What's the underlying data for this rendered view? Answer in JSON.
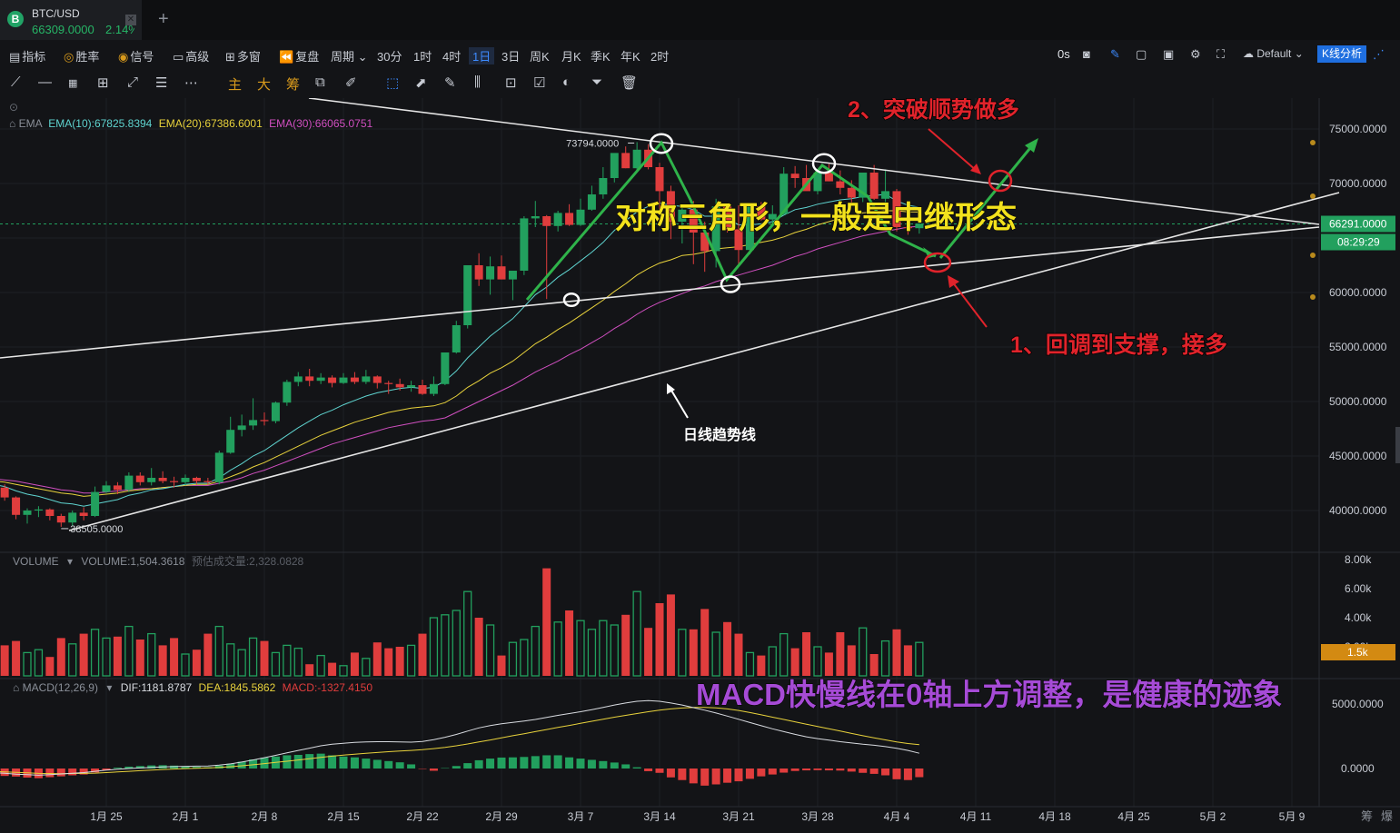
{
  "tab": {
    "symbol": "BTC/USD",
    "price": "66309.0000",
    "change": "2.14%",
    "logo": "B"
  },
  "toolbar": {
    "left": [
      {
        "label": "指标",
        "icon": "indicator-icon"
      },
      {
        "label": "胜率",
        "icon": "winrate-icon"
      },
      {
        "label": "信号",
        "icon": "signal-icon"
      },
      {
        "label": "高级",
        "icon": "advanced-icon"
      },
      {
        "label": "多窗",
        "icon": "multiwindow-icon"
      },
      {
        "label": "复盘",
        "icon": "replay-icon"
      },
      {
        "label": "周期"
      }
    ],
    "periods": [
      "30分",
      "1时",
      "4时",
      "1日",
      "3日",
      "周K",
      "月K",
      "季K",
      "年K",
      "2时"
    ],
    "selected_period": "1日",
    "right_zero": "0s",
    "theme": "Default",
    "kline_button": "K线分析"
  },
  "drawing_tools": {
    "text_tools": [
      "主",
      "大",
      "筹"
    ]
  },
  "ema_legend": {
    "name": "EMA",
    "ema10": "EMA(10):67825.8394",
    "ema20": "EMA(20):67386.6001",
    "ema30": "EMA(30):66065.0751"
  },
  "volume_legend": {
    "name": "VOLUME",
    "value": "VOLUME:1,504.3618",
    "estimate": "预估成交量:2,328.0828"
  },
  "macd_legend": {
    "name": "MACD(12,26,9)",
    "dif": "DIF:1181.8787",
    "dea": "DEA:1845.5862",
    "macd": "MACD:-1327.4150"
  },
  "price_axis": {
    "ticks": [
      "75000.0000",
      "70000.0000",
      "65000.0000",
      "60000.0000",
      "55000.0000",
      "50000.0000",
      "45000.0000",
      "40000.0000"
    ],
    "current": "66291.0000",
    "countdown": "08:29:29"
  },
  "volume_axis": {
    "ticks": [
      "8.00k",
      "6.00k",
      "4.00k",
      "2.00k"
    ],
    "current": "1.5k"
  },
  "macd_axis": {
    "ticks": [
      "5000.0000",
      "0.0000"
    ]
  },
  "date_axis": [
    "1月 25",
    "2月 1",
    "2月 8",
    "2月 15",
    "2月 22",
    "2月 29",
    "3月 7",
    "3月 14",
    "3月 21",
    "3月 28",
    "4月 4",
    "4月 11",
    "4月 18",
    "4月 25",
    "5月 2",
    "5月 9"
  ],
  "corner_labels": [
    "筹",
    "爆"
  ],
  "markers": {
    "high": "73794.0000",
    "low": "38505.0000"
  },
  "annotations": {
    "title": "对称三角形，一般是中继形态",
    "step2": "2、突破顺势做多",
    "step1": "1、回调到支撑，接多",
    "trendline": "日线趋势线",
    "macd_note": "MACD快慢线在0轴上方调整，是健康的迹象"
  },
  "colors": {
    "up": "#22a05e",
    "down": "#e03d3d",
    "ema10": "#5fd4d0",
    "ema20": "#e8d23c",
    "ema30": "#d04fc0",
    "accent": "#3d8bff",
    "note_yellow": "#f3e21d",
    "note_red": "#e0232b",
    "note_purple": "#a64bd6"
  },
  "chart_data": {
    "type": "candlestick",
    "x_start": "2024-01-14",
    "ohlc": [
      [
        42800,
        43100,
        41600,
        41900
      ],
      [
        41900,
        42600,
        41000,
        42100
      ],
      [
        42100,
        42400,
        40900,
        41200
      ],
      [
        41200,
        41300,
        39200,
        39600
      ],
      [
        39600,
        40200,
        38800,
        40000
      ],
      [
        40000,
        40400,
        39400,
        40100
      ],
      [
        40100,
        40200,
        39100,
        39500
      ],
      [
        39500,
        39700,
        38505,
        38900
      ],
      [
        38900,
        40000,
        38600,
        39800
      ],
      [
        39800,
        40300,
        39100,
        39500
      ],
      [
        39500,
        42200,
        39400,
        41700
      ],
      [
        41700,
        42700,
        41600,
        42300
      ],
      [
        42300,
        42600,
        41500,
        41900
      ],
      [
        41900,
        43500,
        41700,
        43200
      ],
      [
        43200,
        43500,
        42300,
        42600
      ],
      [
        42600,
        43900,
        42300,
        43000
      ],
      [
        43000,
        43600,
        42500,
        42700
      ],
      [
        42700,
        43100,
        42100,
        42600
      ],
      [
        42600,
        43300,
        42300,
        43000
      ],
      [
        43000,
        43100,
        42400,
        42700
      ],
      [
        42700,
        43000,
        42400,
        42600
      ],
      [
        42600,
        45500,
        42400,
        45300
      ],
      [
        45300,
        48600,
        45200,
        47400
      ],
      [
        47400,
        48800,
        46800,
        47800
      ],
      [
        47800,
        50300,
        47400,
        48300
      ],
      [
        48300,
        49000,
        47800,
        48200
      ],
      [
        48200,
        50000,
        48000,
        49900
      ],
      [
        49900,
        52000,
        49600,
        51800
      ],
      [
        51800,
        52700,
        51400,
        52300
      ],
      [
        52300,
        53000,
        51400,
        51900
      ],
      [
        51900,
        52600,
        51600,
        52200
      ],
      [
        52200,
        52400,
        51300,
        51700
      ],
      [
        51700,
        52600,
        51600,
        52200
      ],
      [
        52200,
        52700,
        51600,
        51800
      ],
      [
        51800,
        52900,
        51600,
        52300
      ],
      [
        52300,
        52400,
        51200,
        51700
      ],
      [
        51700,
        51900,
        50700,
        51600
      ],
      [
        51600,
        52100,
        51000,
        51300
      ],
      [
        51300,
        51900,
        50900,
        51500
      ],
      [
        51500,
        52000,
        50600,
        50700
      ],
      [
        50700,
        52300,
        50500,
        51600
      ],
      [
        51600,
        54000,
        51500,
        54500
      ],
      [
        54500,
        57400,
        54400,
        57000
      ],
      [
        57000,
        61000,
        56700,
        62500
      ],
      [
        62500,
        63600,
        60600,
        61200
      ],
      [
        61200,
        63300,
        59800,
        62400
      ],
      [
        62400,
        63400,
        61200,
        61200
      ],
      [
        61200,
        62000,
        59300,
        62000
      ],
      [
        62000,
        67000,
        61600,
        66800
      ],
      [
        66800,
        68400,
        66000,
        67000
      ],
      [
        67000,
        67100,
        59400,
        66100
      ],
      [
        66100,
        67500,
        65600,
        67300
      ],
      [
        67300,
        68100,
        66100,
        66200
      ],
      [
        66200,
        68600,
        66100,
        67600
      ],
      [
        67600,
        69800,
        67500,
        69000
      ],
      [
        69000,
        71500,
        68600,
        70500
      ],
      [
        70500,
        72700,
        70100,
        72800
      ],
      [
        72800,
        73400,
        71400,
        71400
      ],
      [
        71400,
        73794,
        71000,
        73100
      ],
      [
        73100,
        73600,
        71300,
        71500
      ],
      [
        71500,
        71900,
        67100,
        69300
      ],
      [
        69300,
        69800,
        64900,
        66500
      ],
      [
        66500,
        68000,
        64500,
        67600
      ],
      [
        67600,
        68400,
        62600,
        65500
      ],
      [
        65500,
        66500,
        61900,
        63800
      ],
      [
        63800,
        68600,
        62300,
        67900
      ],
      [
        67900,
        68100,
        65500,
        65800
      ],
      [
        65800,
        68000,
        62500,
        63900
      ],
      [
        63900,
        68000,
        63500,
        67900
      ],
      [
        67900,
        68300,
        66600,
        66700
      ],
      [
        66700,
        68000,
        66200,
        67200
      ],
      [
        67200,
        71500,
        67100,
        70900
      ],
      [
        70900,
        71600,
        69600,
        70500
      ],
      [
        70500,
        71700,
        69600,
        69300
      ],
      [
        69300,
        71200,
        69000,
        71000
      ],
      [
        71000,
        71800,
        70200,
        70200
      ],
      [
        70200,
        71200,
        69000,
        69600
      ],
      [
        69600,
        70300,
        68000,
        68700
      ],
      [
        68700,
        71000,
        68300,
        71000
      ],
      [
        71000,
        71700,
        68500,
        68600
      ],
      [
        68600,
        71300,
        68300,
        69300
      ],
      [
        69300,
        69500,
        65600,
        66000
      ],
      [
        66000,
        68000,
        65300,
        65900
      ],
      [
        65900,
        67300,
        65400,
        66309
      ]
    ],
    "volume": [
      2.2,
      1.9,
      2.1,
      2.4,
      1.6,
      1.8,
      1.3,
      2.6,
      2.2,
      2.9,
      3.2,
      2.6,
      2.7,
      3.4,
      2.5,
      2.9,
      2.1,
      2.6,
      1.5,
      1.8,
      2.9,
      3.4,
      2.2,
      1.8,
      2.6,
      2.4,
      1.6,
      2.1,
      1.9,
      0.8,
      1.4,
      0.9,
      0.7,
      1.6,
      1.2,
      2.3,
      1.9,
      2.0,
      2.1,
      2.9,
      4.0,
      4.2,
      4.5,
      5.8,
      4.0,
      3.5,
      1.4,
      2.3,
      2.5,
      3.4,
      7.4,
      3.7,
      4.5,
      3.8,
      3.2,
      3.8,
      3.5,
      4.2,
      5.8,
      3.3,
      5.0,
      5.6,
      3.2,
      3.2,
      4.6,
      3.0,
      3.7,
      2.9,
      1.6,
      1.4,
      2.0,
      2.9,
      1.9,
      3.0,
      2.0,
      1.6,
      3.0,
      2.1,
      3.3,
      1.5,
      2.4,
      3.2,
      2.1,
      2.3
    ],
    "macd_hist": [
      -320,
      -330,
      -360,
      -390,
      -440,
      -470,
      -420,
      -380,
      -330,
      -290,
      -190,
      -80,
      40,
      90,
      120,
      150,
      160,
      140,
      110,
      80,
      60,
      140,
      230,
      330,
      440,
      520,
      580,
      640,
      660,
      700,
      720,
      640,
      580,
      540,
      480,
      420,
      360,
      300,
      200,
      -20,
      -110,
      20,
      120,
      260,
      400,
      480,
      530,
      540,
      560,
      600,
      640,
      640,
      540,
      480,
      420,
      360,
      290,
      200,
      60,
      -130,
      -210,
      -430,
      -560,
      -720,
      -830,
      -770,
      -690,
      -620,
      -500,
      -380,
      -290,
      -200,
      -120,
      -90,
      -80,
      -90,
      -100,
      -150,
      -210,
      -260,
      -330,
      -520,
      -560,
      -420
    ],
    "dif": [
      -280,
      -320,
      -370,
      -440,
      -480,
      -520,
      -470,
      -420,
      -370,
      -320,
      -220,
      -120,
      -60,
      0,
      40,
      80,
      120,
      150,
      170,
      180,
      200,
      260,
      360,
      500,
      660,
      840,
      1020,
      1220,
      1400,
      1580,
      1760,
      1880,
      1960,
      2020,
      2060,
      2080,
      2080,
      2060,
      2040,
      2100,
      2240,
      2420,
      2640,
      2900,
      3150,
      3330,
      3470,
      3580,
      3680,
      3800,
      3960,
      4120,
      4260,
      4400,
      4560,
      4740,
      4920,
      5080,
      5210,
      5260,
      5210,
      5080,
      4920,
      4720,
      4520,
      4300,
      4060,
      3820,
      3560,
      3320,
      3080,
      2860,
      2650,
      2460,
      2320,
      2200,
      2080,
      1980,
      1880,
      1800,
      1700,
      1560,
      1400,
      1181.8787
    ],
    "dea": [
      -200,
      -230,
      -260,
      -300,
      -340,
      -380,
      -390,
      -400,
      -390,
      -380,
      -360,
      -320,
      -270,
      -220,
      -170,
      -120,
      -80,
      -40,
      -10,
      20,
      40,
      80,
      140,
      210,
      290,
      380,
      470,
      560,
      660,
      760,
      860,
      960,
      1040,
      1110,
      1180,
      1240,
      1300,
      1360,
      1400,
      1460,
      1540,
      1640,
      1760,
      1900,
      2060,
      2210,
      2380,
      2540,
      2700,
      2860,
      3020,
      3180,
      3340,
      3500,
      3660,
      3820,
      3980,
      4120,
      4260,
      4400,
      4520,
      4620,
      4690,
      4730,
      4740,
      4700,
      4620,
      4500,
      4340,
      4160,
      3980,
      3800,
      3620,
      3440,
      3260,
      3080,
      2900,
      2720,
      2540,
      2380,
      2220,
      2060,
      1940,
      1845.5862
    ],
    "ema10": [
      42500,
      42400,
      42200,
      41800,
      41500,
      41300,
      41000,
      40700,
      40600,
      40400,
      40600,
      40800,
      41000,
      41400,
      41600,
      41900,
      42000,
      42200,
      42400,
      42500,
      42500,
      43000,
      43700,
      44300,
      45000,
      45500,
      46200,
      46900,
      47600,
      48200,
      48800,
      49200,
      49700,
      50100,
      50500,
      50800,
      51000,
      51200,
      51300,
      51200,
      51300,
      51900,
      52800,
      54000,
      55000,
      56000,
      56800,
      57600,
      58700,
      59800,
      60500,
      61400,
      62100,
      62900,
      63700,
      64600,
      65700,
      66600,
      67400,
      67900,
      68200,
      68000,
      67900,
      67600,
      67000,
      67000,
      66800,
      66200,
      66200,
      66300,
      66500,
      67100,
      67600,
      67800,
      68100,
      68300,
      68500,
      68600,
      68800,
      68900,
      69000,
      68400,
      68000,
      67825.8394
    ],
    "ema20": [
      42800,
      42700,
      42600,
      42400,
      42200,
      42000,
      41800,
      41600,
      41500,
      41300,
      41400,
      41500,
      41600,
      41800,
      41900,
      42000,
      42100,
      42200,
      42300,
      42400,
      42400,
      42700,
      43100,
      43500,
      44000,
      44400,
      44900,
      45400,
      45900,
      46400,
      46900,
      47300,
      47700,
      48100,
      48400,
      48700,
      49000,
      49200,
      49400,
      49500,
      49600,
      49900,
      50500,
      51300,
      51900,
      52600,
      53100,
      53700,
      54500,
      55300,
      55900,
      56600,
      57200,
      57900,
      58600,
      59300,
      60100,
      60800,
      61600,
      62200,
      62700,
      63000,
      63400,
      63500,
      63700,
      64000,
      64100,
      64200,
      64400,
      64600,
      64800,
      65100,
      65500,
      65800,
      66200,
      66500,
      66800,
      67000,
      67300,
      67400,
      67500,
      67500,
      67400,
      67386.6001
    ],
    "ema30": [
      43000,
      42900,
      42800,
      42700,
      42500,
      42300,
      42100,
      41900,
      41800,
      41600,
      41600,
      41700,
      41800,
      41900,
      42000,
      42000,
      42100,
      42200,
      42300,
      42300,
      42300,
      42500,
      42700,
      43000,
      43400,
      43700,
      44100,
      44500,
      44900,
      45300,
      45700,
      46100,
      46400,
      46700,
      47000,
      47300,
      47600,
      47800,
      48000,
      48200,
      48300,
      48500,
      49000,
      49500,
      50000,
      50500,
      51000,
      51500,
      52100,
      52700,
      53200,
      53700,
      54300,
      54800,
      55400,
      56000,
      56700,
      57300,
      58000,
      58600,
      59100,
      59500,
      59900,
      60300,
      60600,
      61000,
      61300,
      61600,
      61900,
      62200,
      62500,
      62900,
      63300,
      63600,
      64000,
      64300,
      64600,
      64900,
      65200,
      65400,
      65600,
      65800,
      66000,
      66065.0751
    ]
  }
}
